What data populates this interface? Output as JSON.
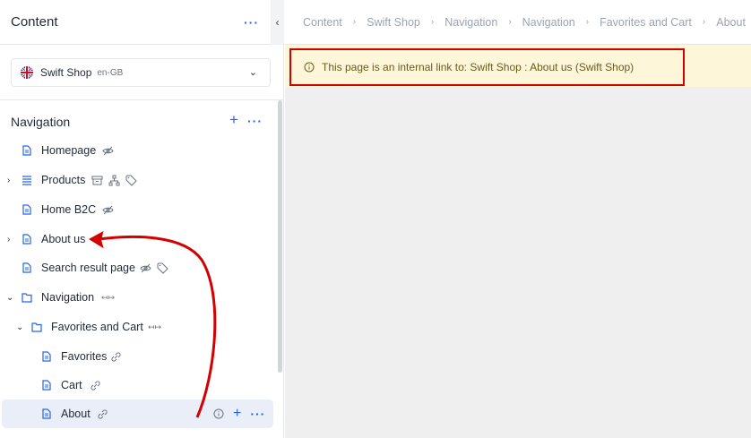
{
  "left_panel": {
    "title": "Content",
    "site": {
      "name": "Swift Shop",
      "lang": "en-GB"
    },
    "navigation_title": "Navigation",
    "tree": [
      {
        "label": "Homepage",
        "name": "tree-item-homepage"
      },
      {
        "label": "Products",
        "name": "tree-item-products"
      },
      {
        "label": "Home B2C",
        "name": "tree-item-home-b2c"
      },
      {
        "label": "About us",
        "name": "tree-item-about-us"
      },
      {
        "label": "Search result page",
        "name": "tree-item-search-result-page"
      },
      {
        "label": "Navigation",
        "name": "tree-item-navigation"
      },
      {
        "label": "Favorites and Cart",
        "name": "tree-item-favorites-and-cart"
      },
      {
        "label": "Favorites",
        "name": "tree-item-favorites"
      },
      {
        "label": "Cart",
        "name": "tree-item-cart"
      },
      {
        "label": "About",
        "name": "tree-item-about"
      }
    ]
  },
  "breadcrumb": [
    "Content",
    "Swift Shop",
    "Navigation",
    "Navigation",
    "Favorites and Cart",
    "About"
  ],
  "info": {
    "text": "This page is an internal link to: Swift Shop : About us (Swift Shop)"
  },
  "colors": {
    "accent": "#2563eb",
    "annotation": "#d40000",
    "info_bg": "#fdf6d8",
    "selected_bg": "#e9eef8"
  },
  "icons": [
    "chevron-left-icon",
    "chevron-down-icon",
    "uk-flag-icon",
    "page-icon",
    "list-icon",
    "folder-icon",
    "hidden-eye-icon",
    "archive-icon",
    "sitemap-icon",
    "tag-icon",
    "link-icon",
    "arrows-icon",
    "info-icon",
    "plus-icon",
    "more-icon"
  ]
}
